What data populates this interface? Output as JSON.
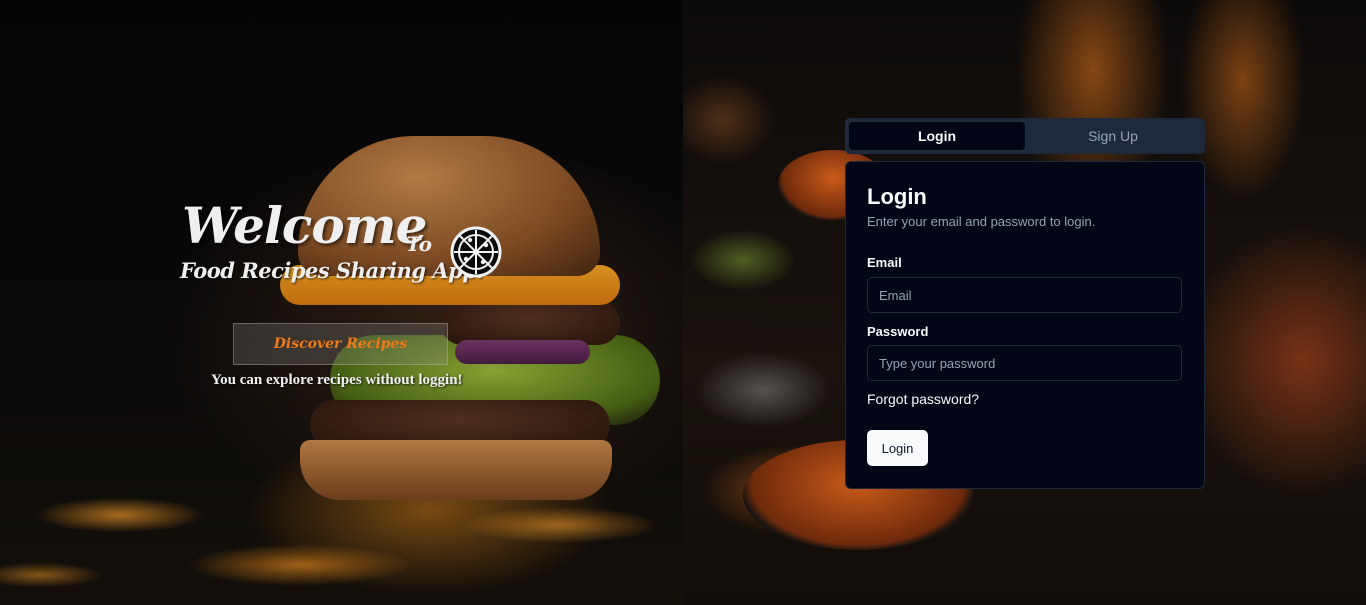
{
  "hero": {
    "welcome": "Welcome",
    "to": "To",
    "app_name": "Food Recipes Sharing App!",
    "discover_button": "Discover Recipes",
    "explore_text": "You can explore recipes without loggin!"
  },
  "auth": {
    "tabs": [
      {
        "label": "Login",
        "active": true
      },
      {
        "label": "Sign Up",
        "active": false
      }
    ],
    "card": {
      "title": "Login",
      "subtitle": "Enter your email and password to login.",
      "email_label": "Email",
      "email_placeholder": "Email",
      "password_label": "Password",
      "password_placeholder": "Type your password",
      "forgot_link": "Forgot password?",
      "submit_label": "Login"
    }
  },
  "icons": {
    "logo": "pizza-icon"
  },
  "colors": {
    "accent_orange": "#f07a16",
    "card_bg": "#020617",
    "tab_bg": "#1e293b",
    "muted_text": "#94a3b8",
    "button_bg": "#f8fafc"
  }
}
